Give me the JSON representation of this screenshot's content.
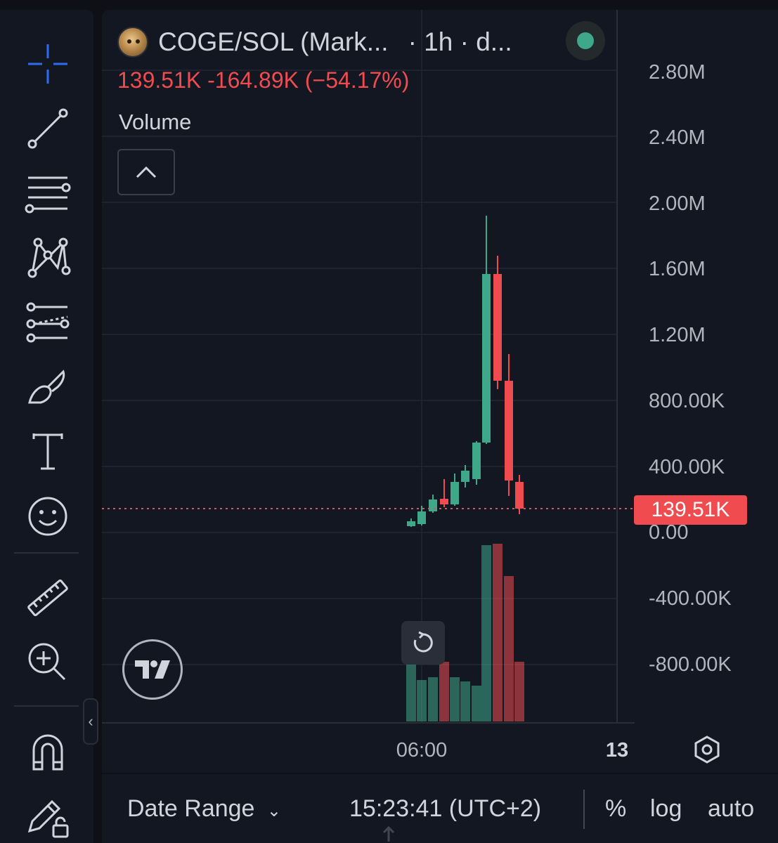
{
  "toolbar": {
    "tools": [
      "crosshair-icon",
      "trend-line-icon",
      "fib-retracement-icon",
      "pattern-icon",
      "prediction-icon",
      "brush-icon",
      "text-icon",
      "emoji-icon",
      "ruler-icon",
      "zoom-in-icon",
      "magnet-icon",
      "lock-drawing-icon"
    ]
  },
  "chart": {
    "symbol_title": "COGE/SOL (Mark...",
    "interval_text": "· 1h · d...",
    "ohlc_text": "139.51K  -164.89K (−54.17%)",
    "volume_label": "Volume",
    "price_axis": [
      "2.80M",
      "2.40M",
      "2.00M",
      "1.60M",
      "1.20M",
      "800.00K",
      "400.00K",
      "0.00",
      "-400.00K",
      "-800.00K"
    ],
    "last_price": "139.51K",
    "time_axis": {
      "label_1": "06:00",
      "label_2": "13"
    },
    "colors": {
      "up": "#3fa88b",
      "down": "#f04c50",
      "background": "#131722",
      "grid": "#1f2330"
    }
  },
  "bottom_bar": {
    "date_range": "Date Range",
    "time": "15:23:41 (UTC+2)",
    "percent": "%",
    "log": "log",
    "auto": "auto"
  }
}
